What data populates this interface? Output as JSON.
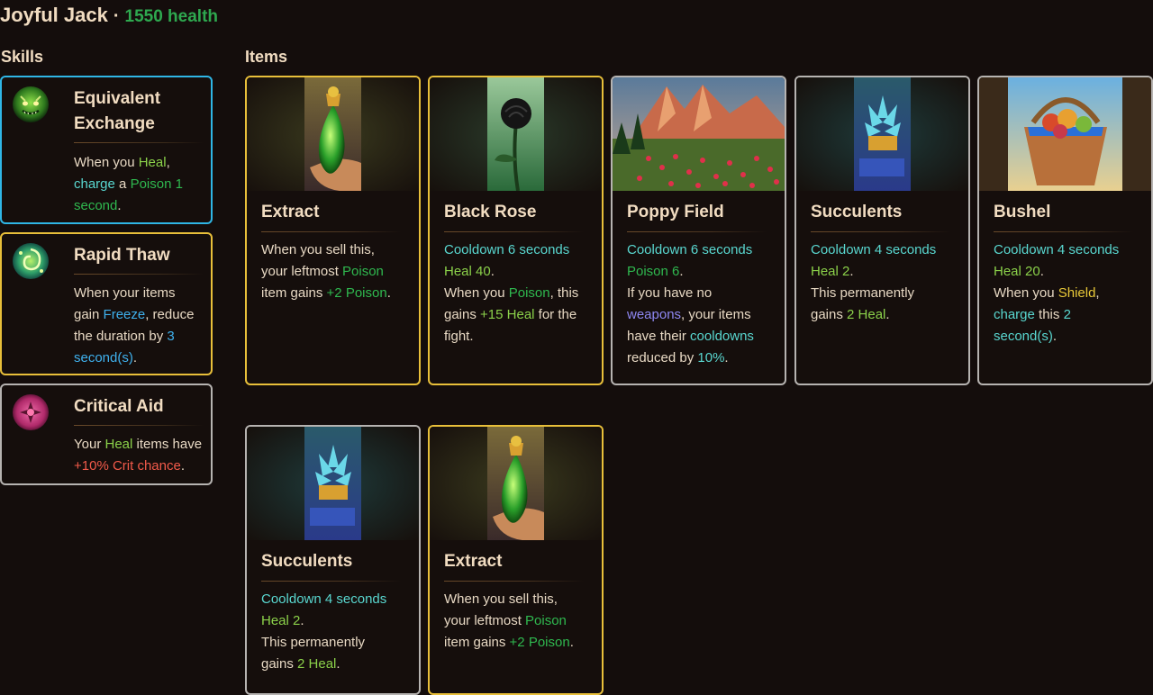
{
  "header": {
    "title": "Joyful Jack",
    "separator": "·",
    "health": "1550 health"
  },
  "sections": {
    "skills": "Skills",
    "items": "Items"
  },
  "skills": [
    {
      "name_line1": "Equivalent",
      "name_line2": "Exchange",
      "icon": "green-monster-icon",
      "desc": [
        [
          [
            "When you ",
            "white"
          ],
          [
            "Heal",
            "heal"
          ],
          [
            ",",
            "white"
          ]
        ],
        [
          [
            "charge",
            "cool"
          ],
          [
            " a ",
            "white"
          ],
          [
            "Poison 1",
            "poison"
          ]
        ],
        [
          [
            "second",
            "poison"
          ],
          [
            ".",
            "white"
          ]
        ]
      ]
    },
    {
      "name_line1": "Rapid Thaw",
      "name_line2": "",
      "icon": "green-swirl-icon",
      "desc": [
        [
          [
            "When your items",
            "white"
          ]
        ],
        [
          [
            "gain ",
            "white"
          ],
          [
            "Freeze",
            "freeze"
          ],
          [
            ", reduce",
            "white"
          ]
        ],
        [
          [
            "the duration by ",
            "white"
          ],
          [
            "3",
            "freeze"
          ]
        ],
        [
          [
            "second(s)",
            "freeze"
          ],
          [
            ".",
            "white"
          ]
        ]
      ]
    },
    {
      "name_line1": "Critical Aid",
      "name_line2": "",
      "icon": "pink-mask-icon",
      "desc": [
        [
          [
            "Your ",
            "white"
          ],
          [
            "Heal",
            "heal"
          ],
          [
            " items have",
            "white"
          ]
        ],
        [
          [
            "+10% Crit chance",
            "crit"
          ],
          [
            ".",
            "white"
          ]
        ]
      ]
    }
  ],
  "items": [
    {
      "name": "Extract",
      "art": "extract-potion-art",
      "desc": [
        [
          [
            "When you sell this,",
            "white"
          ]
        ],
        [
          [
            "your leftmost ",
            "white"
          ],
          [
            "Poison",
            "poison"
          ]
        ],
        [
          [
            "item gains ",
            "white"
          ],
          [
            "+2 Poison",
            "poison"
          ],
          [
            ".",
            "white"
          ]
        ]
      ]
    },
    {
      "name": "Black Rose",
      "art": "black-rose-art",
      "desc": [
        [
          [
            "Cooldown 6 seconds",
            "cool"
          ]
        ],
        [
          [
            "Heal 40",
            "heal"
          ],
          [
            ".",
            "white"
          ]
        ],
        [
          [
            "When you ",
            "white"
          ],
          [
            "Poison",
            "poison"
          ],
          [
            ", this",
            "white"
          ]
        ],
        [
          [
            "gains ",
            "white"
          ],
          [
            "+15 Heal",
            "heal"
          ],
          [
            " for the",
            "white"
          ]
        ],
        [
          [
            "fight.",
            "white"
          ]
        ]
      ]
    },
    {
      "name": "Poppy Field",
      "art": "poppy-field-art",
      "desc": [
        [
          [
            "Cooldown 6 seconds",
            "cool"
          ]
        ],
        [
          [
            "Poison 6",
            "poison"
          ],
          [
            ".",
            "white"
          ]
        ],
        [
          [
            "If you have no",
            "white"
          ]
        ],
        [
          [
            "weapons",
            "weapon"
          ],
          [
            ", your items",
            "white"
          ]
        ],
        [
          [
            "have their ",
            "white"
          ],
          [
            "cooldowns",
            "cool"
          ]
        ],
        [
          [
            "reduced by ",
            "white"
          ],
          [
            "10%",
            "cool"
          ],
          [
            ".",
            "white"
          ]
        ]
      ]
    },
    {
      "name": "Succulents",
      "art": "succulents-art",
      "desc": [
        [
          [
            "Cooldown 4 seconds",
            "cool"
          ]
        ],
        [
          [
            "Heal 2",
            "heal"
          ],
          [
            ".",
            "white"
          ]
        ],
        [
          [
            "This permanently",
            "white"
          ]
        ],
        [
          [
            "gains ",
            "white"
          ],
          [
            "2 Heal",
            "heal"
          ],
          [
            ".",
            "white"
          ]
        ]
      ]
    },
    {
      "name": "Bushel",
      "art": "bushel-basket-art",
      "desc": [
        [
          [
            "Cooldown 4 seconds",
            "cool"
          ]
        ],
        [
          [
            "Heal 20",
            "heal"
          ],
          [
            ".",
            "white"
          ]
        ],
        [
          [
            "When you ",
            "white"
          ],
          [
            "Shield",
            "shield"
          ],
          [
            ",",
            "white"
          ]
        ],
        [
          [
            "charge",
            "cool"
          ],
          [
            " this ",
            "white"
          ],
          [
            "2",
            "cool"
          ]
        ],
        [
          [
            "second(s)",
            "cool"
          ],
          [
            ".",
            "white"
          ]
        ]
      ]
    },
    {
      "name": "Succulents",
      "art": "succulents-art",
      "desc": [
        [
          [
            "Cooldown 4 seconds",
            "cool"
          ]
        ],
        [
          [
            "Heal 2",
            "heal"
          ],
          [
            ".",
            "white"
          ]
        ],
        [
          [
            "This permanently",
            "white"
          ]
        ],
        [
          [
            "gains ",
            "white"
          ],
          [
            "2 Heal",
            "heal"
          ],
          [
            ".",
            "white"
          ]
        ]
      ]
    },
    {
      "name": "Extract",
      "art": "extract-potion-art",
      "desc": [
        [
          [
            "When you sell this,",
            "white"
          ]
        ],
        [
          [
            "your leftmost ",
            "white"
          ],
          [
            "Poison",
            "poison"
          ]
        ],
        [
          [
            "item gains ",
            "white"
          ],
          [
            "+2 Poison",
            "poison"
          ],
          [
            ".",
            "white"
          ]
        ]
      ]
    }
  ]
}
